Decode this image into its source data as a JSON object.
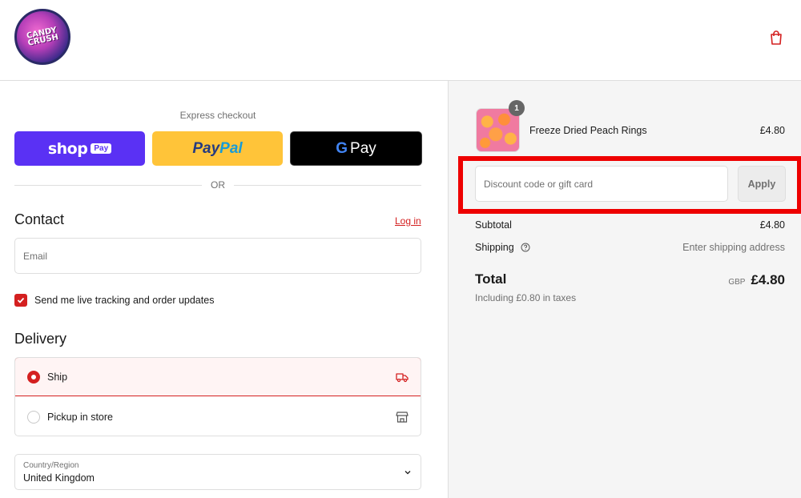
{
  "header": {
    "logo_text": "CANDY CRUSH",
    "cart_icon": "shopping-bag-icon",
    "accent_color": "#d42020"
  },
  "express": {
    "title": "Express checkout",
    "shop_pay": {
      "word": "shop",
      "badge": "Pay"
    },
    "paypal": {
      "part1": "Pay",
      "part2": "Pal"
    },
    "gpay": {
      "g": "G",
      "pay": "Pay"
    },
    "or": "OR"
  },
  "contact": {
    "heading": "Contact",
    "login": "Log in",
    "email_placeholder": "Email",
    "updates_label": "Send me live tracking and order updates",
    "updates_checked": true
  },
  "delivery": {
    "heading": "Delivery",
    "options": [
      {
        "label": "Ship",
        "selected": true,
        "icon": "truck-icon"
      },
      {
        "label": "Pickup in store",
        "selected": false,
        "icon": "store-icon"
      }
    ],
    "country_label": "Country/Region",
    "country_value": "United Kingdom"
  },
  "summary": {
    "item": {
      "name": "Freeze Dried Peach Rings",
      "price": "£4.80",
      "qty": "1"
    },
    "discount_placeholder": "Discount code or gift card",
    "apply": "Apply",
    "subtotal_label": "Subtotal",
    "subtotal_value": "£4.80",
    "shipping_label": "Shipping",
    "shipping_value": "Enter shipping address",
    "total_label": "Total",
    "currency": "GBP",
    "total_value": "£4.80",
    "tax_note": "Including £0.80 in taxes"
  }
}
